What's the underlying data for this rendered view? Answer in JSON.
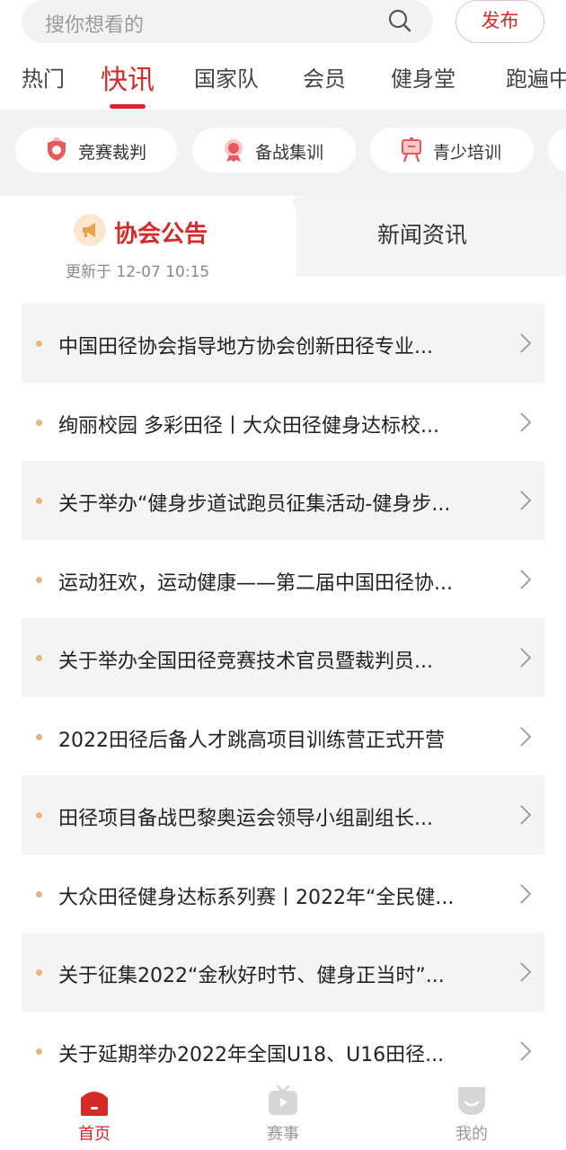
{
  "search": {
    "placeholder": "搜你想看的",
    "publish_label": "发布"
  },
  "tabs": [
    {
      "label": "热门"
    },
    {
      "label": "快讯",
      "active": true
    },
    {
      "label": "国家队"
    },
    {
      "label": "会员"
    },
    {
      "label": "健身堂"
    },
    {
      "label": "跑遍中"
    }
  ],
  "categories": [
    {
      "label": "竞赛裁判",
      "icon": "shield-badge-icon"
    },
    {
      "label": "备战集训",
      "icon": "medal-icon"
    },
    {
      "label": "青少培训",
      "icon": "easel-board-icon"
    }
  ],
  "segment": {
    "notice_title": "协会公告",
    "updated": "更新于 12-07 10:15",
    "news_label": "新闻资讯"
  },
  "items": [
    {
      "title": "中国田径协会指导地方协会创新田径专业..."
    },
    {
      "title": "绚丽校园 多彩田径丨大众田径健身达标校..."
    },
    {
      "title": "关于举办“健身步道试跑员征集活动-健身步..."
    },
    {
      "title": "运动狂欢，运动健康——第二届中国田径协..."
    },
    {
      "title": "关于举办全国田径竞赛技术官员暨裁判员..."
    },
    {
      "title": "2022田径后备人才跳高项目训练营正式开营"
    },
    {
      "title": "田径项目备战巴黎奥运会领导小组副组长..."
    },
    {
      "title": "大众田径健身达标系列赛丨2022年“全民健..."
    },
    {
      "title": "关于征集2022“金秋好时节、健身正当时”..."
    },
    {
      "title": "关于延期举办2022年全国U18、U16田径..."
    }
  ],
  "bottom_nav": [
    {
      "label": "首页",
      "icon": "home-icon",
      "active": true
    },
    {
      "label": "赛事",
      "icon": "tv-play-icon"
    },
    {
      "label": "我的",
      "icon": "user-face-icon"
    }
  ],
  "colors": {
    "accent": "#d42a2a",
    "dot": "#e7b57d",
    "strip_bg": "#f2f2f2"
  }
}
